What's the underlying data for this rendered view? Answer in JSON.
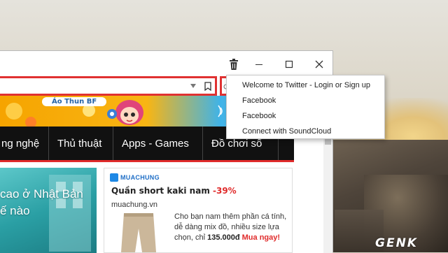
{
  "browser": {
    "title_bar": {
      "buttons": [
        "minimize",
        "maximize",
        "close"
      ],
      "trash_icon": "trash-icon"
    },
    "tabs_visible": false
  },
  "page": {
    "banner": {
      "shirt_label": "Áo Thun BF"
    },
    "nav": {
      "items": [
        "ng nghệ",
        "Thủ thuật",
        "Apps - Games",
        "Đồ chơi số"
      ]
    },
    "hero": {
      "lines": [
        "cao ở Nhật Bản",
        "ế nào"
      ]
    },
    "ad": {
      "logo": "MUACHUNG",
      "title": "Quần short kaki nam ",
      "discount": "-39%",
      "source": "muachung.vn",
      "desc_prefix": "Cho bạn nam thêm phần cá tính, dễ dàng mix đồ, nhiều size lựa chọn, chỉ ",
      "price": "135.000đ",
      "cta": "Mua ngay!"
    }
  },
  "context_menu": {
    "items": [
      "Welcome to Twitter - Login or Sign up",
      "Facebook",
      "Facebook",
      "Connect with SoundCloud"
    ]
  },
  "watermark": "GENK",
  "colors": {
    "highlight_red": "#e03131",
    "nav_bg": "#111111",
    "accent_red": "#e02b2b"
  }
}
